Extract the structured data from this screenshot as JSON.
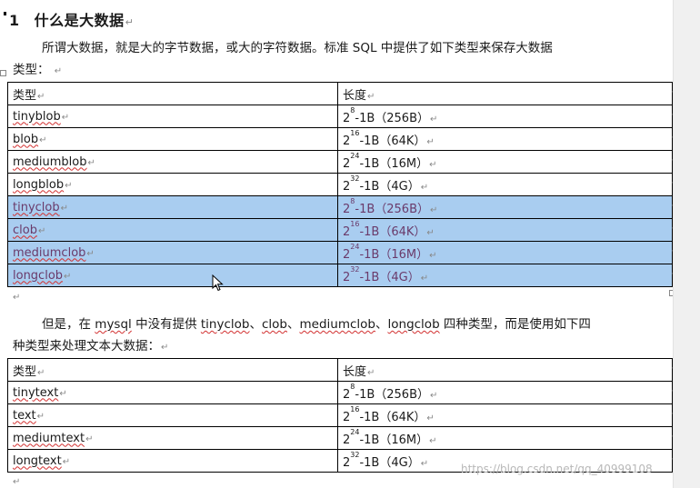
{
  "heading": {
    "number": "1",
    "title": "什么是大数据"
  },
  "intro": {
    "text": "所谓大数据，就是大的字节数据，或大的字符数据。标准 SQL 中提供了如下类型来保存大数据",
    "text_cont": "类型："
  },
  "table1": {
    "header": {
      "type": "类型",
      "length": "长度"
    },
    "rows": [
      {
        "type": "tinyblob",
        "base": "2",
        "exp": "8",
        "rest": "-1B（256B）"
      },
      {
        "type": "blob",
        "base": "2",
        "exp": "16",
        "rest": "-1B（64K）"
      },
      {
        "type": "mediumblob",
        "base": "2",
        "exp": "24",
        "rest": "-1B（16M）"
      },
      {
        "type": "longblob",
        "base": "2",
        "exp": "32",
        "rest": "-1B（4G）"
      },
      {
        "type": "tinyclob",
        "base": "2",
        "exp": "8",
        "rest": "-1B（256B）"
      },
      {
        "type": "clob",
        "base": "2",
        "exp": "16",
        "rest": "-1B（64K）"
      },
      {
        "type": "mediumclob",
        "base": "2",
        "exp": "24",
        "rest": "-1B（16M）"
      },
      {
        "type": "longclob",
        "base": "2",
        "exp": "32",
        "rest": "-1B（4G）"
      }
    ]
  },
  "para2": {
    "p1": "但是，在 ",
    "w1": "mysql",
    "p2": " 中没有提供 ",
    "w2": "tinyclob",
    "p3": "、",
    "w3": "clob",
    "p4": "、",
    "w4": "mediumclob",
    "p5": "、",
    "w5": "longclob",
    "p6": " 四种类型，而是使用如下四",
    "line2": "种类型来处理文本大数据："
  },
  "table2": {
    "header": {
      "type": "类型",
      "length": "长度"
    },
    "rows": [
      {
        "type": "tinytext",
        "base": "2",
        "exp": "8",
        "rest": "-1B（256B）"
      },
      {
        "type": "text",
        "base": "2",
        "exp": "16",
        "rest": "-1B（64K）"
      },
      {
        "type": "mediumtext",
        "base": "2",
        "exp": "24",
        "rest": "-1B（16M）"
      },
      {
        "type": "longtext",
        "base": "2",
        "exp": "32",
        "rest": "-1B（4G）"
      }
    ]
  },
  "marks": {
    "paragraph": "↵"
  },
  "watermark": "https://blog.csdn.net/qq_40999108",
  "colors": {
    "selection": "#a9cdf0",
    "spell_underline": "#d23030"
  }
}
